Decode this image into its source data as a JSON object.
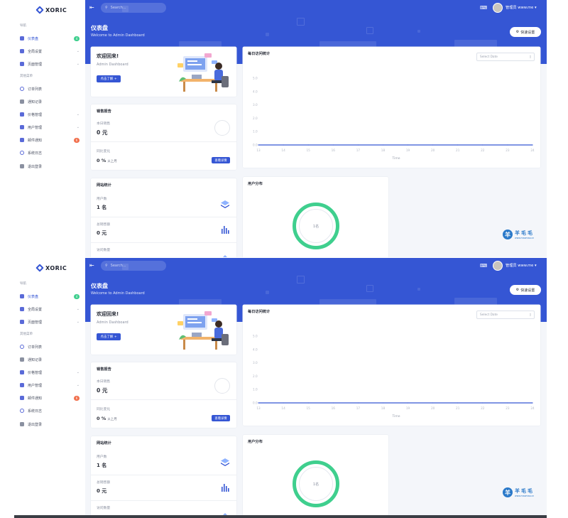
{
  "app": {
    "brand": "XORIC"
  },
  "sidebar": {
    "group1": "导航",
    "group2": "其他菜单",
    "items": [
      {
        "label": "仪表盘",
        "badge": "4",
        "chevron": false
      },
      {
        "label": "全局设置",
        "badge": "",
        "chevron": true
      },
      {
        "label": "页面管理",
        "badge": "",
        "chevron": true
      },
      {
        "label": "订单列表",
        "badge": "",
        "chevron": false
      },
      {
        "label": "通知记录",
        "badge": "",
        "chevron": false
      },
      {
        "label": "价格管理",
        "badge": "",
        "chevron": true
      },
      {
        "label": "用户管理",
        "badge": "",
        "chevron": true
      },
      {
        "label": "邮件通知",
        "badge": "6",
        "chevron": false
      },
      {
        "label": "系统日志",
        "badge": "",
        "chevron": false
      },
      {
        "label": "退出登录",
        "badge": "",
        "chevron": false
      }
    ]
  },
  "topbar": {
    "search_placeholder": "Search...",
    "user_name": "管理员 www.me",
    "user_chevron": "▾"
  },
  "header": {
    "title": "仪表盘",
    "subtitle": "Welcome to Admin Dashboard",
    "quick_btn": "快速设置"
  },
  "welcome": {
    "title": "欢迎回来!",
    "subtitle": "Admin Dashboard",
    "button": "点击了解 +"
  },
  "sales": {
    "title": "销售报告",
    "today_label": "本日销售",
    "today_value": "0 元",
    "compare_label": "同比变化",
    "compare_value": "0 %",
    "compare_note": "从上月",
    "button": "查看详情"
  },
  "site": {
    "title": "网站统计",
    "rows": [
      {
        "label": "用户数",
        "value": "1 名"
      },
      {
        "label": "总销售额",
        "value": "0 元"
      },
      {
        "label": "访问数量",
        "value": ""
      }
    ]
  },
  "visit": {
    "title": "每日访问统计",
    "date_placeholder": "Select Date",
    "xlabel": "Time"
  },
  "chart_data": {
    "type": "line",
    "title": "每日访问统计",
    "xlabel": "Time",
    "ylabel": "",
    "x": [
      "13",
      "14",
      "15",
      "16",
      "17",
      "18",
      "19",
      "20",
      "21",
      "22",
      "23",
      "24"
    ],
    "series": [
      {
        "values": [
          0,
          0,
          0,
          0,
          0,
          0,
          0,
          0,
          0,
          0,
          0,
          0
        ]
      }
    ],
    "y_ticks": [
      "0.0",
      "1.0",
      "2.0",
      "3.0",
      "4.0",
      "5.0"
    ],
    "ylim": [
      0,
      5
    ]
  },
  "dist": {
    "title": "用户分布",
    "center": "1名"
  },
  "watermark": {
    "text": "羊毛毛",
    "sub": "www.maomao.cn"
  },
  "colors": {
    "primary": "#3556d4",
    "green": "#3fcf8e",
    "red": "#f1704d"
  }
}
